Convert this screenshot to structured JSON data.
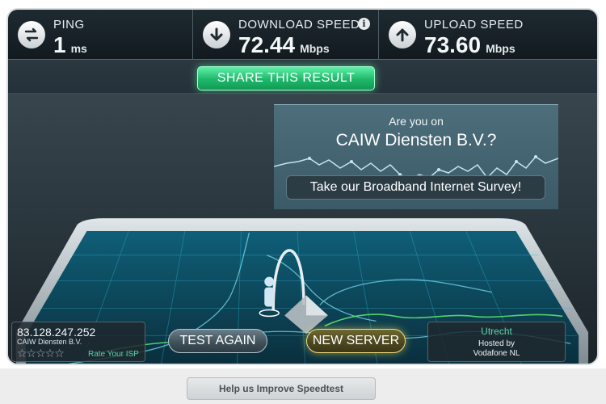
{
  "stats": {
    "ping": {
      "label": "PING",
      "value": "1",
      "unit": "ms",
      "icon": "exchange-arrows-icon"
    },
    "download": {
      "label": "DOWNLOAD SPEED",
      "value": "72.44",
      "unit": "Mbps",
      "icon": "download-arrow-icon",
      "info": "i"
    },
    "upload": {
      "label": "UPLOAD SPEED",
      "value": "73.60",
      "unit": "Mbps",
      "icon": "upload-arrow-icon"
    }
  },
  "share": {
    "label": "SHARE THIS RESULT"
  },
  "survey": {
    "question_line1": "Are you on",
    "question_line2": "CAIW Diensten B.V.?",
    "button": "Take our Broadband Internet Survey!"
  },
  "client": {
    "ip": "83.128.247.252",
    "isp": "CAIW Diensten B.V.",
    "stars": "☆☆☆☆☆",
    "rate_link": "Rate Your ISP"
  },
  "buttons": {
    "test_again": "TEST AGAIN",
    "new_server": "NEW SERVER"
  },
  "server": {
    "city": "Utrecht",
    "hosted_by": "Hosted by",
    "host": "Vodafone NL"
  },
  "footer": {
    "label": "Help us Improve Speedtest"
  },
  "colors": {
    "accent_green": "#1fb86b",
    "accent_gold": "#f5e27b",
    "link_green": "#58d3a4",
    "panel_bg": "#2a353c"
  }
}
